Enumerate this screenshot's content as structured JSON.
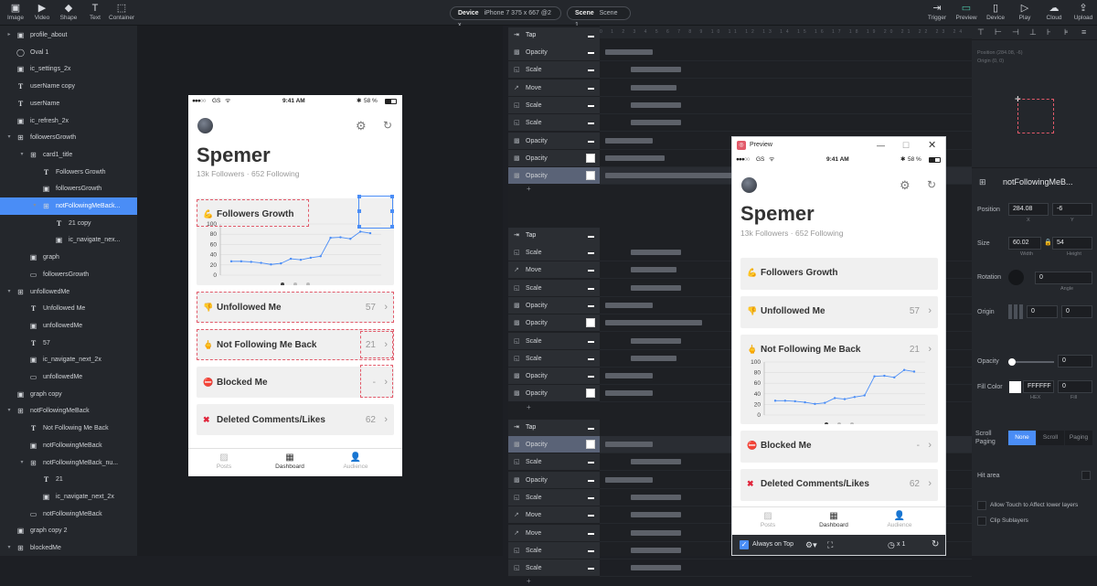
{
  "toolbar": {
    "left_items": [
      {
        "label": "Image",
        "icon": "image-icon"
      },
      {
        "label": "Video",
        "icon": "video-icon"
      },
      {
        "label": "Shape",
        "icon": "shape-icon"
      },
      {
        "label": "Text",
        "icon": "text-icon"
      },
      {
        "label": "Container",
        "icon": "container-icon"
      }
    ],
    "device_label": "Device",
    "device_value": "iPhone 7  375 x 667  @2 x",
    "scene_label": "Scene",
    "scene_value": "Scene 1",
    "right_items": [
      {
        "label": "Trigger",
        "icon": "trigger-icon"
      },
      {
        "label": "Preview",
        "icon": "preview-icon"
      },
      {
        "label": "Device",
        "icon": "device-icon"
      },
      {
        "label": "Play",
        "icon": "play-icon"
      },
      {
        "label": "Cloud",
        "icon": "cloud-icon"
      },
      {
        "label": "Upload",
        "icon": "upload-icon"
      }
    ]
  },
  "layers": [
    {
      "name": "profile_about",
      "indent": 1,
      "icon": "image",
      "twisty": "▸"
    },
    {
      "name": "Oval 1",
      "indent": 1,
      "icon": "oval",
      "twisty": ""
    },
    {
      "name": "ic_settings_2x",
      "indent": 1,
      "icon": "image",
      "twisty": ""
    },
    {
      "name": "userName copy",
      "indent": 1,
      "icon": "text",
      "twisty": ""
    },
    {
      "name": "userName",
      "indent": 1,
      "icon": "text",
      "twisty": ""
    },
    {
      "name": "ic_refresh_2x",
      "indent": 1,
      "icon": "image",
      "twisty": ""
    },
    {
      "name": "followersGrowth",
      "indent": 1,
      "icon": "container",
      "twisty": "▾"
    },
    {
      "name": "card1_title",
      "indent": 2,
      "icon": "container",
      "twisty": "▾"
    },
    {
      "name": "Followers Growth",
      "indent": 3,
      "icon": "text",
      "twisty": ""
    },
    {
      "name": "followersGrowth",
      "indent": 3,
      "icon": "image",
      "twisty": ""
    },
    {
      "name": "notFollowingMeBack...",
      "indent": 3,
      "icon": "container",
      "twisty": "▾",
      "selected": true
    },
    {
      "name": "21 copy",
      "indent": 4,
      "icon": "text",
      "twisty": ""
    },
    {
      "name": "ic_navigate_nex...",
      "indent": 4,
      "icon": "image",
      "twisty": ""
    },
    {
      "name": "graph",
      "indent": 2,
      "icon": "image",
      "twisty": ""
    },
    {
      "name": "followersGrowth",
      "indent": 2,
      "icon": "rect",
      "twisty": ""
    },
    {
      "name": "unfollowedMe",
      "indent": 1,
      "icon": "container",
      "twisty": "▾"
    },
    {
      "name": "Unfollowed Me",
      "indent": 2,
      "icon": "text",
      "twisty": ""
    },
    {
      "name": "unfollowedMe",
      "indent": 2,
      "icon": "image",
      "twisty": ""
    },
    {
      "name": "57",
      "indent": 2,
      "icon": "text",
      "twisty": ""
    },
    {
      "name": "ic_navigate_next_2x",
      "indent": 2,
      "icon": "image",
      "twisty": ""
    },
    {
      "name": "unfollowedMe",
      "indent": 2,
      "icon": "rect",
      "twisty": ""
    },
    {
      "name": "graph copy",
      "indent": 1,
      "icon": "image",
      "twisty": ""
    },
    {
      "name": "notFollowingMeBack",
      "indent": 1,
      "icon": "container",
      "twisty": "▾"
    },
    {
      "name": "Not Following Me Back",
      "indent": 2,
      "icon": "text",
      "twisty": ""
    },
    {
      "name": "notFollowingMeBack",
      "indent": 2,
      "icon": "image",
      "twisty": ""
    },
    {
      "name": "notFollowingMeBack_nu...",
      "indent": 2,
      "icon": "container",
      "twisty": "▾"
    },
    {
      "name": "21",
      "indent": 3,
      "icon": "text",
      "twisty": ""
    },
    {
      "name": "ic_navigate_next_2x",
      "indent": 3,
      "icon": "image",
      "twisty": ""
    },
    {
      "name": "notFollowingMeBack",
      "indent": 2,
      "icon": "rect",
      "twisty": ""
    },
    {
      "name": "graph copy 2",
      "indent": 1,
      "icon": "image",
      "twisty": ""
    },
    {
      "name": "blockedMe",
      "indent": 1,
      "icon": "container",
      "twisty": "▾"
    }
  ],
  "phone": {
    "carrier": "GS",
    "time": "9:41 AM",
    "battery": "58 %",
    "name": "Spemer",
    "stats": "13k Followers · 652 Following",
    "cards": [
      {
        "emoji": "💪",
        "label": "Followers Growth",
        "count": ""
      },
      {
        "emoji": "👎",
        "label": "Unfollowed Me",
        "count": "57"
      },
      {
        "emoji": "🖕",
        "label": "Not Following Me Back",
        "count": "21"
      },
      {
        "emoji": "⛔",
        "label": "Blocked Me",
        "count": "-"
      },
      {
        "emoji": "✖",
        "label": "Deleted Comments/Likes",
        "count": "62"
      }
    ],
    "tabs": [
      "Posts",
      "Dashboard",
      "Audience"
    ]
  },
  "chart_data": {
    "type": "line",
    "yticks": [
      "100",
      "80",
      "60",
      "40",
      "20",
      "0"
    ],
    "ylim": [
      0,
      100
    ],
    "values": [
      27,
      27,
      26,
      24,
      21,
      23,
      32,
      30,
      34,
      37,
      73,
      74,
      71,
      85,
      82
    ],
    "color": "#4a8df6",
    "dots": 3,
    "dot_active": 0
  },
  "timeline": {
    "groups": [
      {
        "trigger": "Tap",
        "rows": [
          {
            "icon": "opacity",
            "name": "Opacity",
            "sel": false,
            "marker": "dash"
          },
          {
            "icon": "scale",
            "name": "Scale",
            "sel": false,
            "marker": "dash"
          },
          {
            "icon": "move",
            "name": "Move",
            "sel": false,
            "marker": "dash"
          },
          {
            "icon": "scale",
            "name": "Scale",
            "sel": false,
            "marker": "dash"
          },
          {
            "icon": "scale",
            "name": "Scale",
            "sel": false,
            "marker": "dash"
          },
          {
            "icon": "opacity",
            "name": "Opacity",
            "sel": false,
            "marker": "dash"
          },
          {
            "icon": "opacity",
            "name": "Opacity",
            "sel": false,
            "marker": "swatch"
          },
          {
            "icon": "opacity",
            "name": "Opacity",
            "sel": true,
            "marker": "swatch"
          }
        ]
      },
      {
        "trigger": "Tap",
        "rows": [
          {
            "icon": "scale",
            "name": "Scale",
            "sel": false,
            "marker": "dash"
          },
          {
            "icon": "move",
            "name": "Move",
            "sel": false,
            "marker": "dash"
          },
          {
            "icon": "scale",
            "name": "Scale",
            "sel": false,
            "marker": "dash"
          },
          {
            "icon": "opacity",
            "name": "Opacity",
            "sel": false,
            "marker": "dash"
          },
          {
            "icon": "opacity",
            "name": "Opacity",
            "sel": false,
            "marker": "swatch"
          },
          {
            "icon": "scale",
            "name": "Scale",
            "sel": false,
            "marker": "dash"
          },
          {
            "icon": "scale",
            "name": "Scale",
            "sel": false,
            "marker": "dash"
          },
          {
            "icon": "opacity",
            "name": "Opacity",
            "sel": false,
            "marker": "dash"
          },
          {
            "icon": "opacity",
            "name": "Opacity",
            "sel": false,
            "marker": "swatch"
          }
        ]
      },
      {
        "trigger": "Tap",
        "rows": [
          {
            "icon": "opacity",
            "name": "Opacity",
            "sel": true,
            "marker": "swatch"
          },
          {
            "icon": "scale",
            "name": "Scale",
            "sel": false,
            "marker": "dash"
          },
          {
            "icon": "opacity",
            "name": "Opacity",
            "sel": false,
            "marker": "dash"
          },
          {
            "icon": "scale",
            "name": "Scale",
            "sel": false,
            "marker": "dash"
          },
          {
            "icon": "move",
            "name": "Move",
            "sel": false,
            "marker": "dash"
          },
          {
            "icon": "move",
            "name": "Move",
            "sel": false,
            "marker": "dash"
          },
          {
            "icon": "scale",
            "name": "Scale",
            "sel": false,
            "marker": "dash"
          },
          {
            "icon": "scale",
            "name": "Scale",
            "sel": false,
            "marker": "dash"
          }
        ]
      }
    ]
  },
  "preview": {
    "title": "Preview",
    "always_on_top": "Always on Top",
    "speed": "x 1"
  },
  "props": {
    "layer_name": "notFollowingMeB...",
    "top_position": "Position    (284.08, -6)",
    "top_origin": "Origin      (0, 0)",
    "position_label": "Position",
    "pos_x": "284.08",
    "pos_y": "-6",
    "pos_x_sub": "X",
    "pos_y_sub": "Y",
    "size_label": "Size",
    "width": "60.02",
    "height": "54",
    "width_sub": "Width",
    "height_sub": "Height",
    "rotation_label": "Rotation",
    "rotation": "0",
    "angle_sub": "Angle",
    "origin_label": "Origin",
    "origin_x": "0",
    "origin_y": "0",
    "opacity_label": "Opacity",
    "opacity": "0",
    "fill_label": "Fill Color",
    "fill_hex": "FFFFFF",
    "fill_alpha": "0",
    "hex_sub": "HEX",
    "alpha_sub": "Fill",
    "scroll_label": "Scroll Paging",
    "scroll_options": [
      "None",
      "Scroll",
      "Paging"
    ],
    "hit_area_label": "Hit area",
    "allow_touch": "Allow Touch to Affect lower layers",
    "clip_sublayers": "Clip Sublayers"
  }
}
